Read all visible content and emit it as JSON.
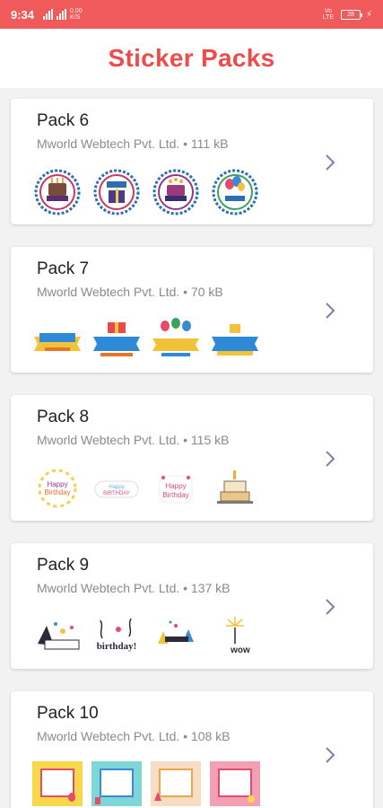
{
  "status": {
    "time": "9:34",
    "net_left": "0.00",
    "net_left2": "K/S",
    "sim_label": "Vo LTE",
    "battery": "28"
  },
  "header": {
    "title": "Sticker Packs"
  },
  "packs": [
    {
      "name": "Pack 6",
      "meta": "Mworld Webtech Pvt. Ltd. • 111 kB",
      "stickers": [
        "birthday-cake-badge-icon",
        "birthday-gift-badge-icon",
        "birthday-cake-badge-icon",
        "birthday-balloons-badge-icon"
      ]
    },
    {
      "name": "Pack 7",
      "meta": "Mworld Webtech Pvt. Ltd. • 70 kB",
      "stickers": [
        "happy-birthday-ribbon-icon",
        "happy-birthday-gift-ribbon-icon",
        "birthday-balloons-ribbon-icon",
        "happy-birthday-cake-ribbon-icon"
      ]
    },
    {
      "name": "Pack 8",
      "meta": "Mworld Webtech Pvt. Ltd. • 115 kB",
      "stickers": [
        "happy-birthday-stars-icon",
        "happy-birthday-cloud-icon",
        "happy-birthday-hearts-icon",
        "birthday-cake-sketch-icon"
      ]
    },
    {
      "name": "Pack 9",
      "meta": "Mworld Webtech Pvt. Ltd. • 137 kB",
      "stickers": [
        "celebrate-party-icon",
        "happy-birthday-lettering-icon",
        "party-hats-confetti-icon",
        "fireworks-wow-icon"
      ]
    },
    {
      "name": "Pack 10",
      "meta": "Mworld Webtech Pvt. Ltd. • 108 kB",
      "stickers": [
        "birthday-frame-yellow-icon",
        "birthday-frame-teal-icon",
        "birthday-frame-peach-icon",
        "birthday-frame-pink-icon"
      ]
    }
  ],
  "colors": {
    "accent": "#ee4b4b",
    "status_bar": "#f15a5a"
  }
}
